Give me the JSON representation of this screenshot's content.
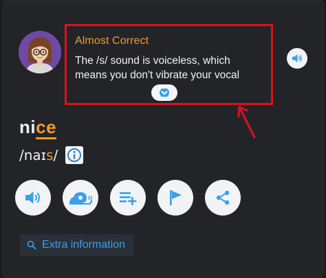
{
  "feedback": {
    "title": "Almost Correct",
    "line1": "The /s/ sound is voiceless, which",
    "line2": "means you don't vibrate your vocal",
    "expand_icon": "chevron-down-icon"
  },
  "word": {
    "plain": "ni",
    "highlight": "ce"
  },
  "phonetic": {
    "before": "/naɪ",
    "highlight": "s",
    "after": "/"
  },
  "actions": [
    {
      "name": "play-audio-button",
      "icon": "speaker-icon"
    },
    {
      "name": "play-slow-button",
      "icon": "snail-icon"
    },
    {
      "name": "add-to-list-button",
      "icon": "playlist-add-icon"
    },
    {
      "name": "flag-button",
      "icon": "flag-icon"
    },
    {
      "name": "share-button",
      "icon": "share-icon"
    }
  ],
  "extra": {
    "label": "Extra information",
    "icon": "search-icon"
  },
  "colors": {
    "accent_orange": "#f39a2b",
    "accent_blue": "#3aa0e8",
    "highlight_red": "#e0101a",
    "background": "#232427"
  }
}
